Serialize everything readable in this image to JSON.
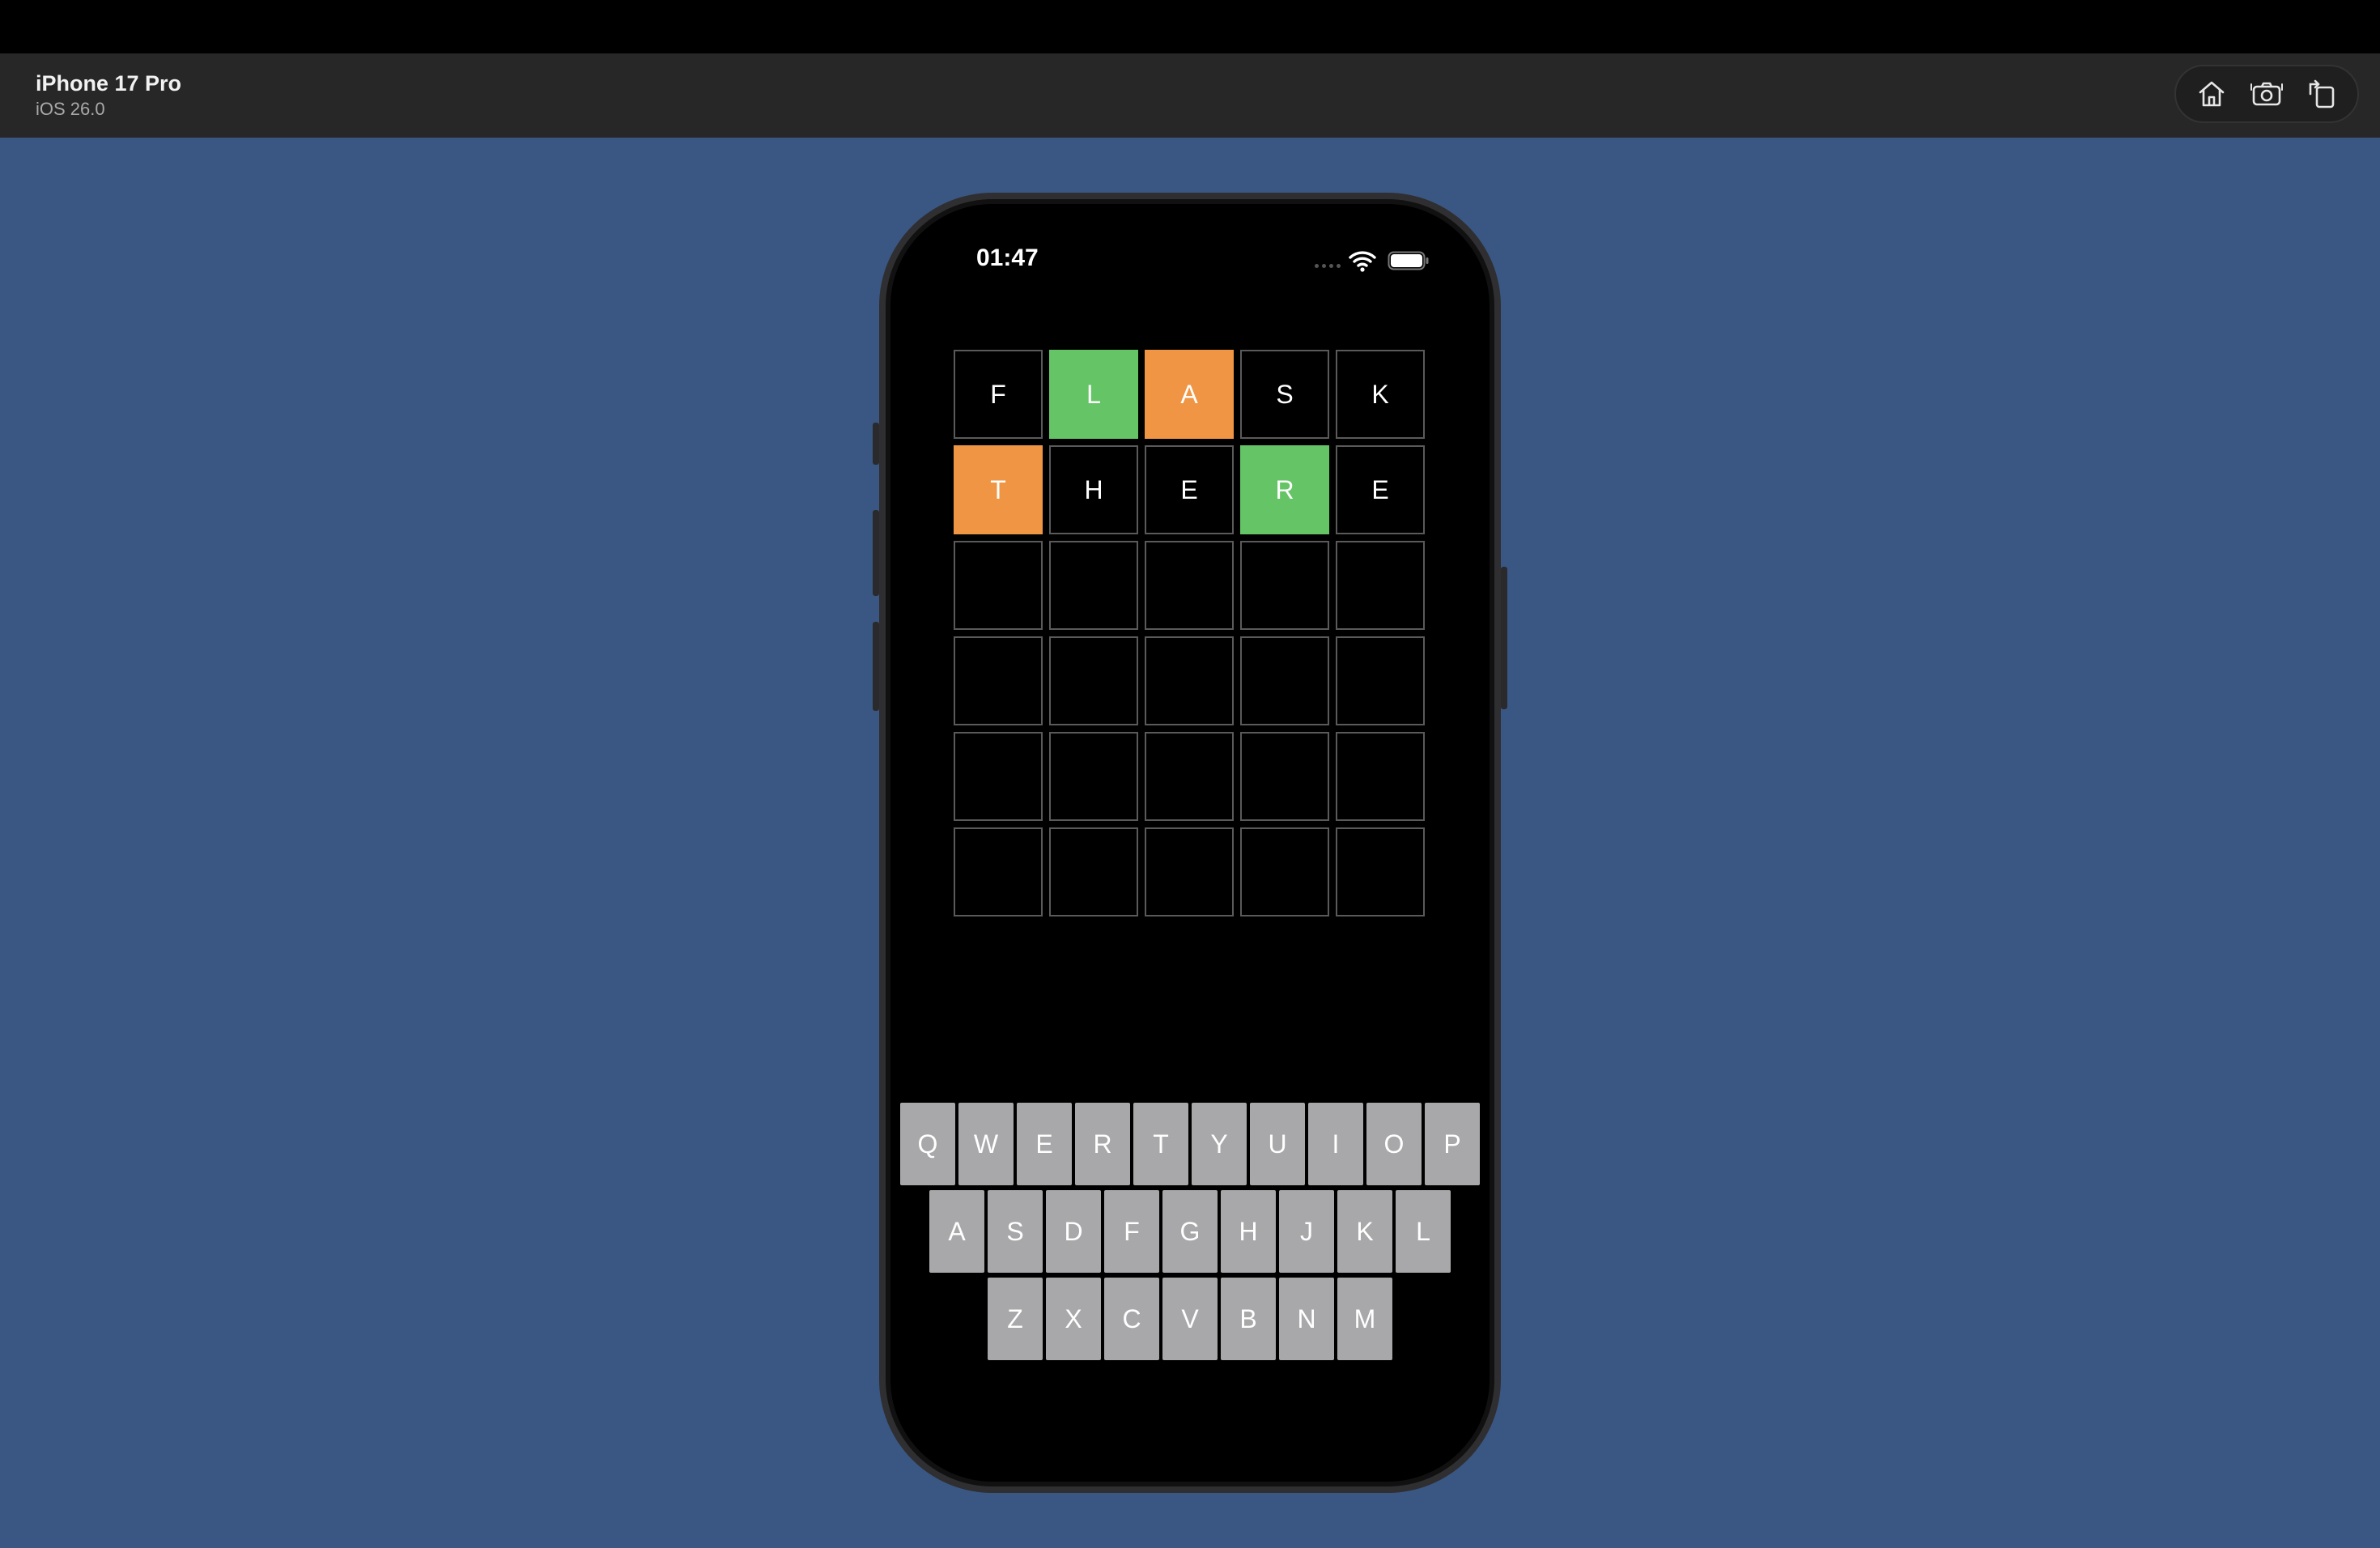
{
  "simulator": {
    "device_name": "iPhone 17 Pro",
    "os_version": "iOS 26.0",
    "toolbar_buttons": [
      {
        "name": "home-icon"
      },
      {
        "name": "screenshot-icon"
      },
      {
        "name": "rotate-icon"
      }
    ],
    "background_color": "#3a5783"
  },
  "status_bar": {
    "time": "01:47"
  },
  "board": {
    "colors": {
      "correct": "#65c466",
      "present": "#ef9543",
      "absent": "#000000"
    },
    "rows": [
      [
        {
          "letter": "F",
          "state": "absent"
        },
        {
          "letter": "L",
          "state": "correct"
        },
        {
          "letter": "A",
          "state": "present"
        },
        {
          "letter": "S",
          "state": "absent"
        },
        {
          "letter": "K",
          "state": "absent"
        }
      ],
      [
        {
          "letter": "T",
          "state": "present"
        },
        {
          "letter": "H",
          "state": "absent"
        },
        {
          "letter": "E",
          "state": "absent"
        },
        {
          "letter": "R",
          "state": "correct"
        },
        {
          "letter": "E",
          "state": "absent"
        }
      ],
      [
        {
          "letter": "",
          "state": "empty"
        },
        {
          "letter": "",
          "state": "empty"
        },
        {
          "letter": "",
          "state": "empty"
        },
        {
          "letter": "",
          "state": "empty"
        },
        {
          "letter": "",
          "state": "empty"
        }
      ],
      [
        {
          "letter": "",
          "state": "empty"
        },
        {
          "letter": "",
          "state": "empty"
        },
        {
          "letter": "",
          "state": "empty"
        },
        {
          "letter": "",
          "state": "empty"
        },
        {
          "letter": "",
          "state": "empty"
        }
      ],
      [
        {
          "letter": "",
          "state": "empty"
        },
        {
          "letter": "",
          "state": "empty"
        },
        {
          "letter": "",
          "state": "empty"
        },
        {
          "letter": "",
          "state": "empty"
        },
        {
          "letter": "",
          "state": "empty"
        }
      ],
      [
        {
          "letter": "",
          "state": "empty"
        },
        {
          "letter": "",
          "state": "empty"
        },
        {
          "letter": "",
          "state": "empty"
        },
        {
          "letter": "",
          "state": "empty"
        },
        {
          "letter": "",
          "state": "empty"
        }
      ]
    ]
  },
  "keyboard": {
    "rows": [
      [
        "Q",
        "W",
        "E",
        "R",
        "T",
        "Y",
        "U",
        "I",
        "O",
        "P"
      ],
      [
        "A",
        "S",
        "D",
        "F",
        "G",
        "H",
        "J",
        "K",
        "L"
      ],
      [
        "Z",
        "X",
        "C",
        "V",
        "B",
        "N",
        "M"
      ]
    ],
    "key_color": "#a8a8aa"
  }
}
